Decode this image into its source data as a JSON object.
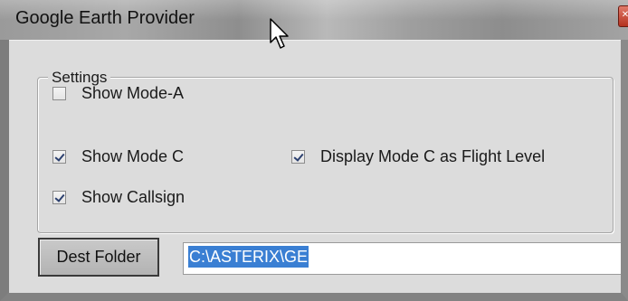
{
  "window": {
    "title": "Google Earth Provider",
    "close_icon": "close-icon"
  },
  "settings": {
    "legend": "Settings",
    "checkboxes": [
      {
        "label": "Show Mode-A",
        "checked": false
      },
      {
        "label": "Show Mode C",
        "checked": true
      },
      {
        "label": "Display Mode C as Flight Level",
        "checked": true
      },
      {
        "label": "Show Callsign",
        "checked": true
      }
    ]
  },
  "dest": {
    "button_label": "Dest Folder",
    "path_value": "C:\\ASTERIX\\GE"
  },
  "colors": {
    "selection": "#3a7fd3",
    "dialog_bg": "#dcdcdc"
  }
}
